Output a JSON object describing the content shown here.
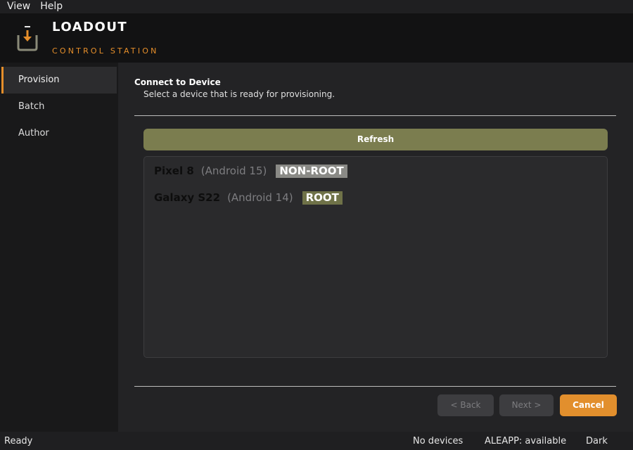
{
  "menu": {
    "items": [
      "View",
      "Help"
    ]
  },
  "header": {
    "title": "LOADOUT",
    "subtitle": "CONTROL STATION",
    "logo_icon": "download-tray-icon"
  },
  "sidebar": {
    "items": [
      {
        "label": "Provision",
        "active": true
      },
      {
        "label": "Batch",
        "active": false
      },
      {
        "label": "Author",
        "active": false
      }
    ]
  },
  "step": {
    "title": "Connect to Device",
    "description": "Select a device that is ready for provisioning."
  },
  "refresh_label": "Refresh",
  "devices": [
    {
      "name": "Pixel 8",
      "os": "(Android 15)",
      "badge": "NON-ROOT"
    },
    {
      "name": "Galaxy S22",
      "os": "(Android 14)",
      "badge": "ROOT"
    }
  ],
  "buttons": {
    "back": "< Back",
    "next": "Next >",
    "cancel": "Cancel"
  },
  "status": {
    "left": "Ready",
    "devices": "No devices",
    "aleapp": "ALEAPP: available",
    "theme": "Dark"
  },
  "colors": {
    "accent": "#e58e2a",
    "refresh": "#7b7d4f",
    "root_badge": "#6f7248",
    "nonroot_badge": "#8a8a86"
  }
}
